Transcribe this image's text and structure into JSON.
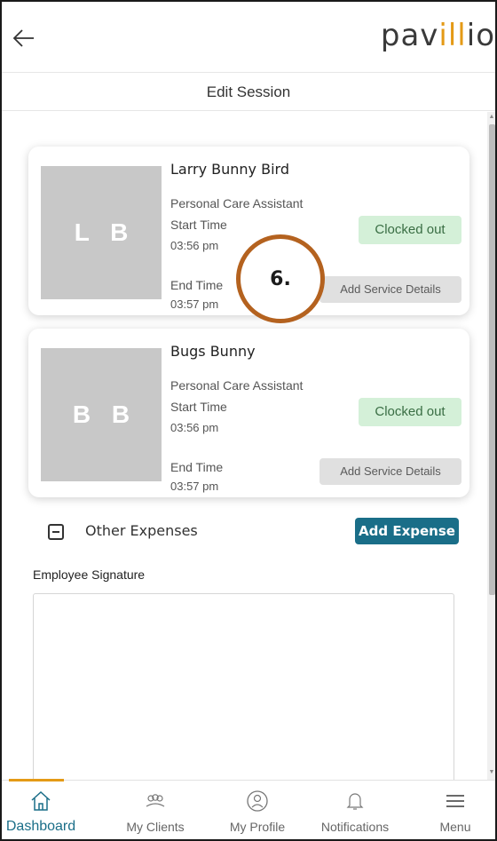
{
  "header": {
    "brand_prefix": "pav",
    "brand_accent": "ill",
    "brand_suffix": "io",
    "title": "Edit Session"
  },
  "sessions": [
    {
      "initials": "L B",
      "name": "Larry Bunny Bird",
      "role": "Personal Care Assistant",
      "start_label": "Start Time",
      "start_time": "03:56 pm",
      "end_label": "End Time",
      "end_time": "03:57 pm",
      "status": "Clocked out",
      "service_button": "Add Service Details"
    },
    {
      "initials": "B B",
      "name": "Bugs Bunny",
      "role": "Personal Care Assistant",
      "start_label": "Start Time",
      "start_time": "03:56 pm",
      "end_label": "End Time",
      "end_time": "03:57 pm",
      "status": "Clocked out",
      "service_button": "Add Service Details"
    }
  ],
  "step_marker": "6.",
  "expenses": {
    "label": "Other Expenses",
    "add_button": "Add Expense"
  },
  "signature": {
    "label": "Employee Signature"
  },
  "bottom_nav": {
    "items": [
      {
        "label": "Dashboard",
        "icon": "home-icon",
        "active": true
      },
      {
        "label": "My Clients",
        "icon": "clients-icon",
        "active": false
      },
      {
        "label": "My Profile",
        "icon": "profile-icon",
        "active": false
      },
      {
        "label": "Notifications",
        "icon": "bell-icon",
        "active": false
      },
      {
        "label": "Menu",
        "icon": "menu-icon",
        "active": false
      }
    ]
  },
  "colors": {
    "brand_accent": "#e49a16",
    "primary": "#1a6e88",
    "status_bg": "#d4f0d8",
    "status_text": "#3a6e44",
    "marker_ring": "#b4621f"
  }
}
